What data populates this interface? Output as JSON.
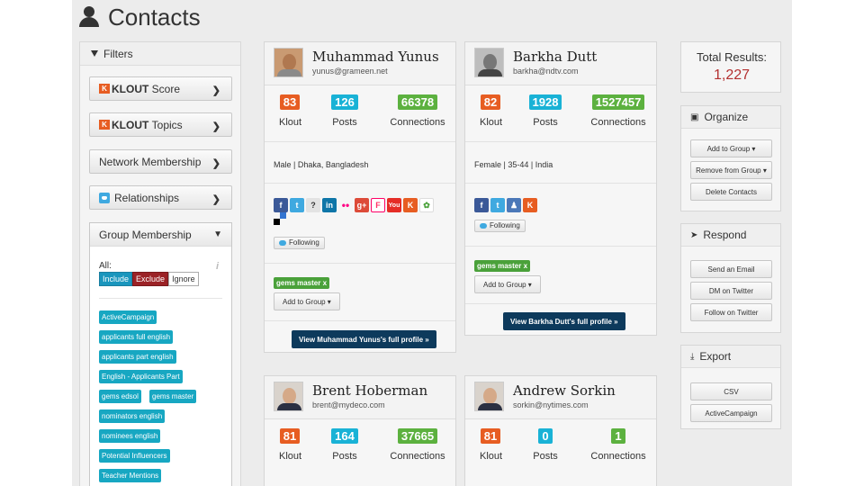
{
  "page_title": "Contacts",
  "filters": {
    "title": "Filters",
    "klout_score": {
      "brand": "KLOUT",
      "label": "Score"
    },
    "klout_topics": {
      "brand": "KLOUT",
      "label": "Topics"
    },
    "network_membership": "Network Membership",
    "relationships": "Relationships",
    "group_membership": {
      "title": "Group Membership",
      "all_label": "All:",
      "include": "Include",
      "exclude": "Exclude",
      "ignore": "Ignore",
      "tags": [
        "ActiveCampaign",
        "applicants full english",
        "applicants part english",
        "English - Applicants Part",
        "gems edsol",
        "gems master",
        "nominators english",
        "nominees english",
        "Potential Influencers",
        "Teacher Mentions"
      ]
    }
  },
  "contacts": [
    {
      "name": "Muhammad Yunus",
      "email": "yunus@grameen.net",
      "klout": "83",
      "posts": "126",
      "connections": "66378",
      "demographics": "Male | Dhaka, Bangladesh",
      "following_label": "Following",
      "group_tag": "gems master x",
      "add_group_label": "Add to Group ▾",
      "profile_link": "View Muhammad Yunus's full profile »"
    },
    {
      "name": "Barkha Dutt",
      "email": "barkha@ndtv.com",
      "klout": "82",
      "posts": "1928",
      "connections": "1527457",
      "demographics": "Female | 35-44 | India",
      "following_label": "Following",
      "group_tag": "gems master x",
      "add_group_label": "Add to Group ▾",
      "profile_link": "View Barkha Dutt's full profile »"
    },
    {
      "name": "Brent Hoberman",
      "email": "brent@mydeco.com",
      "klout": "81",
      "posts": "164",
      "connections": "37665"
    },
    {
      "name": "Andrew Sorkin",
      "email": "sorkin@nytimes.com",
      "klout": "81",
      "posts": "0",
      "connections": "1"
    }
  ],
  "stat_labels": {
    "klout": "Klout",
    "posts": "Posts",
    "connections": "Connections"
  },
  "results": {
    "label": "Total Results:",
    "value": "1,227"
  },
  "organize": {
    "title": "Organize",
    "add": "Add to Group ▾",
    "remove": "Remove from Group ▾",
    "delete": "Delete Contacts"
  },
  "respond": {
    "title": "Respond",
    "email": "Send an Email",
    "dm": "DM on Twitter",
    "follow": "Follow on Twitter"
  },
  "export": {
    "title": "Export",
    "csv": "CSV",
    "activecampaign": "ActiveCampaign"
  },
  "colors": {
    "klout_orange": "#e75d22",
    "posts_cyan": "#19b2d6",
    "connections_green": "#5cb13f",
    "profile_navy": "#0d3a5c",
    "total_red": "#b33030"
  }
}
